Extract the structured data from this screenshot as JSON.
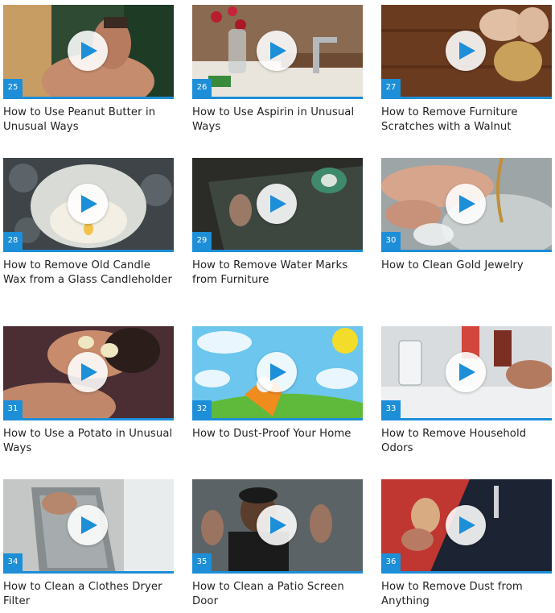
{
  "accent_color": "#1d8ed8",
  "play_icon": "play-icon",
  "videos": [
    {
      "number": "25",
      "title": "How to Use Peanut Butter in Unusual Ways"
    },
    {
      "number": "26",
      "title": "How to Use Aspirin in Unusual Ways"
    },
    {
      "number": "27",
      "title": "How to Remove Furniture Scratches with a Walnut"
    },
    {
      "number": "28",
      "title": "How to Remove Old Candle Wax from a Glass Candleholder"
    },
    {
      "number": "29",
      "title": "How to Remove Water Marks from Furniture"
    },
    {
      "number": "30",
      "title": "How to Clean Gold Jewelry"
    },
    {
      "number": "31",
      "title": "How to Use a Potato in Unusual Ways"
    },
    {
      "number": "32",
      "title": "How to Dust-Proof Your Home"
    },
    {
      "number": "33",
      "title": "How to Remove Household Odors"
    },
    {
      "number": "34",
      "title": "How to Clean a Clothes Dryer Filter"
    },
    {
      "number": "35",
      "title": "How to Clean a Patio Screen Door"
    },
    {
      "number": "36",
      "title": "How to Remove Dust from Anything"
    }
  ]
}
